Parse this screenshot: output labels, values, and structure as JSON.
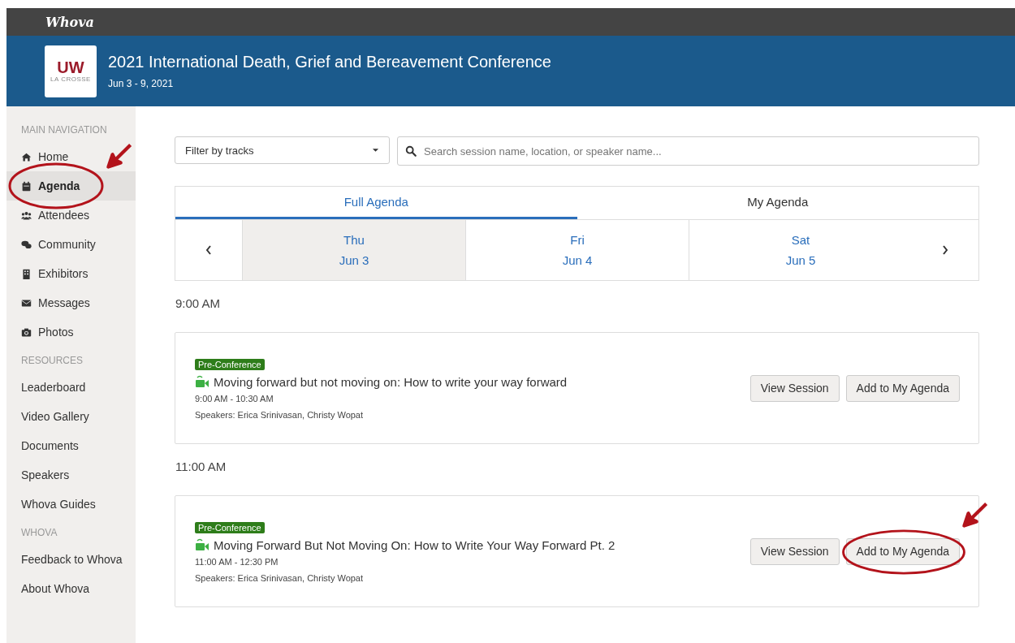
{
  "brand": "Whova",
  "event": {
    "logo_top": "UW",
    "logo_bottom": "LA CROSSE",
    "title": "2021 International Death, Grief and Bereavement Conference",
    "dates": "Jun 3 - 9, 2021"
  },
  "sidebar": {
    "sections": [
      {
        "heading": "MAIN NAVIGATION",
        "items": [
          {
            "label": "Home",
            "selected": false,
            "highlighted": false
          },
          {
            "label": "Agenda",
            "selected": true,
            "highlighted": true
          },
          {
            "label": "Attendees",
            "selected": false,
            "highlighted": false
          },
          {
            "label": "Community",
            "selected": false,
            "highlighted": false
          },
          {
            "label": "Exhibitors",
            "selected": false,
            "highlighted": false
          },
          {
            "label": "Messages",
            "selected": false,
            "highlighted": false
          },
          {
            "label": "Photos",
            "selected": false,
            "highlighted": false
          }
        ]
      },
      {
        "heading": "RESOURCES",
        "items": [
          {
            "label": "Leaderboard",
            "selected": false,
            "highlighted": false
          },
          {
            "label": "Video Gallery",
            "selected": false,
            "highlighted": false
          },
          {
            "label": "Documents",
            "selected": false,
            "highlighted": false
          },
          {
            "label": "Speakers",
            "selected": false,
            "highlighted": false
          },
          {
            "label": "Whova Guides",
            "selected": false,
            "highlighted": false
          }
        ]
      },
      {
        "heading": "WHOVA",
        "items": [
          {
            "label": "Feedback to Whova",
            "selected": false,
            "highlighted": false
          },
          {
            "label": "About Whova",
            "selected": false,
            "highlighted": false
          }
        ]
      }
    ]
  },
  "filter": {
    "label": "Filter by tracks"
  },
  "search": {
    "placeholder": "Search session name, location, or speaker name..."
  },
  "tabs": [
    {
      "label": "Full Agenda",
      "selected": true
    },
    {
      "label": "My Agenda",
      "selected": false
    }
  ],
  "days": [
    {
      "weekday": "Thu",
      "date": "Jun 3",
      "selected": true
    },
    {
      "weekday": "Fri",
      "date": "Jun 4",
      "selected": false
    },
    {
      "weekday": "Sat",
      "date": "Jun 5",
      "selected": false
    }
  ],
  "slots": [
    {
      "time": "9:00 AM",
      "sessions": [
        {
          "tag": "Pre-Conference",
          "title": "Moving forward but not moving on: How to write your way forward",
          "time": "9:00 AM - 10:30 AM",
          "speakers": "Speakers: Erica Srinivasan, Christy Wopat",
          "view": "View Session",
          "add": "Add to My Agenda",
          "add_highlighted": false
        }
      ]
    },
    {
      "time": "11:00 AM",
      "sessions": [
        {
          "tag": "Pre-Conference",
          "title": "Moving Forward But Not Moving On: How to Write Your Way Forward Pt. 2",
          "time": "11:00 AM - 12:30 PM",
          "speakers": "Speakers: Erica Srinivasan, Christy Wopat",
          "view": "View Session",
          "add": "Add to My Agenda",
          "add_highlighted": true
        }
      ]
    }
  ]
}
